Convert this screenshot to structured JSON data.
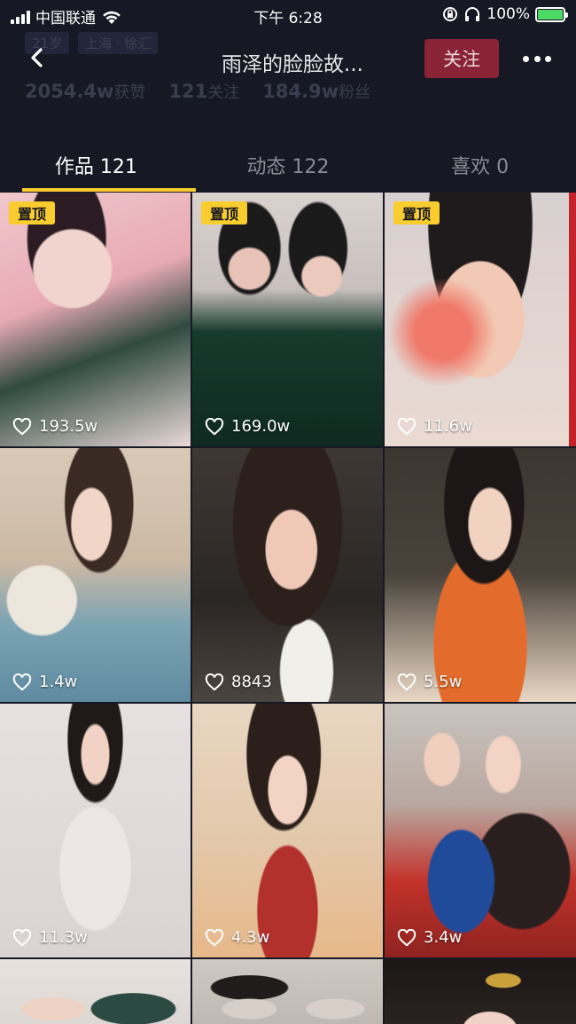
{
  "status_bar": {
    "carrier": "中国联通",
    "time": "下午 6:28",
    "battery": "100%",
    "battery_color": "#4cd964"
  },
  "profile_bg": {
    "age": "21岁",
    "location": "上海 · 徐汇",
    "likes_value": "2054.4w",
    "likes_label": "获赞",
    "following_value": "121",
    "following_label": "关注",
    "fans_value": "184.9w",
    "fans_label": "粉丝"
  },
  "header": {
    "back_icon": "chevron-left-icon",
    "title": "雨泽的脸脸故...",
    "follow_label": "关注",
    "more_icon": "more-dots-icon",
    "follow_color": "#8b2336"
  },
  "tabs": [
    {
      "label": "作品 121",
      "active": true
    },
    {
      "label": "动态 122",
      "active": false
    },
    {
      "label": "喜欢 0",
      "active": false
    }
  ],
  "accent_color": "#facd2f",
  "videos": [
    {
      "pinned": true,
      "pin_label": "置顶",
      "likes": "193.5w"
    },
    {
      "pinned": true,
      "pin_label": "置顶",
      "likes": "169.0w"
    },
    {
      "pinned": true,
      "pin_label": "置顶",
      "likes": "11.6w"
    },
    {
      "pinned": false,
      "likes": "1.4w"
    },
    {
      "pinned": false,
      "likes": "8843"
    },
    {
      "pinned": false,
      "likes": "5.5w"
    },
    {
      "pinned": false,
      "likes": "11.3w"
    },
    {
      "pinned": false,
      "likes": "4.3w"
    },
    {
      "pinned": false,
      "likes": "3.4w"
    }
  ]
}
